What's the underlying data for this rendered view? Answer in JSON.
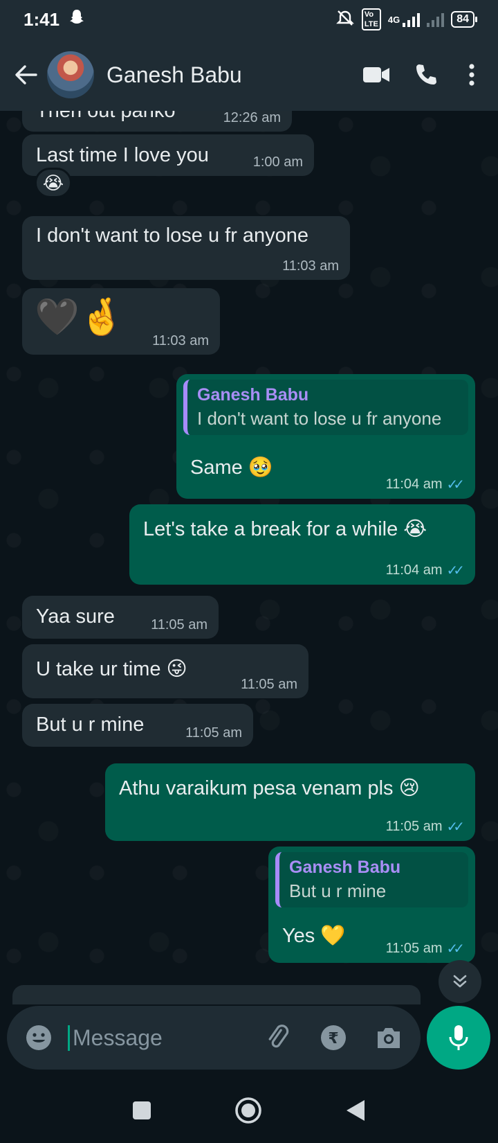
{
  "status_bar": {
    "time": "1:41",
    "battery": "84",
    "network": "4G"
  },
  "header": {
    "contact_name": "Ganesh Babu"
  },
  "messages": [
    {
      "dir": "in",
      "text": "Then out panko",
      "time": "12:26 am"
    },
    {
      "dir": "in",
      "text": "Last time I love you",
      "time": "1:00 am",
      "reaction": "😭"
    },
    {
      "dir": "in",
      "text": "I don't want to lose u fr anyone",
      "time": "11:03 am"
    },
    {
      "dir": "in",
      "text": "🖤🤞",
      "time": "11:03 am"
    },
    {
      "dir": "out",
      "quote_author": "Ganesh Babu",
      "quote_text": "I don't want to lose u fr anyone",
      "text": "Same 🥹",
      "time": "11:04 am"
    },
    {
      "dir": "out",
      "text": "Let's take a break for a while 😭",
      "time": "11:04 am"
    },
    {
      "dir": "in",
      "text": "Yaa sure",
      "time": "11:05 am"
    },
    {
      "dir": "in",
      "text": "U take ur time 😜",
      "time": "11:05 am"
    },
    {
      "dir": "in",
      "text": "But u r mine",
      "time": "11:05 am"
    },
    {
      "dir": "out",
      "text": "Athu varaikum pesa venam pls 😢",
      "time": "11:05 am"
    },
    {
      "dir": "out",
      "quote_author": "Ganesh Babu",
      "quote_text": "But u r mine",
      "text": "Yes 💛",
      "time": "11:05 am"
    }
  ],
  "input": {
    "placeholder": "Message"
  },
  "colors": {
    "incoming_bubble": "#202c33",
    "outgoing_bubble": "#005c4b",
    "accent": "#00a884",
    "read_ticks": "#53bdeb"
  }
}
